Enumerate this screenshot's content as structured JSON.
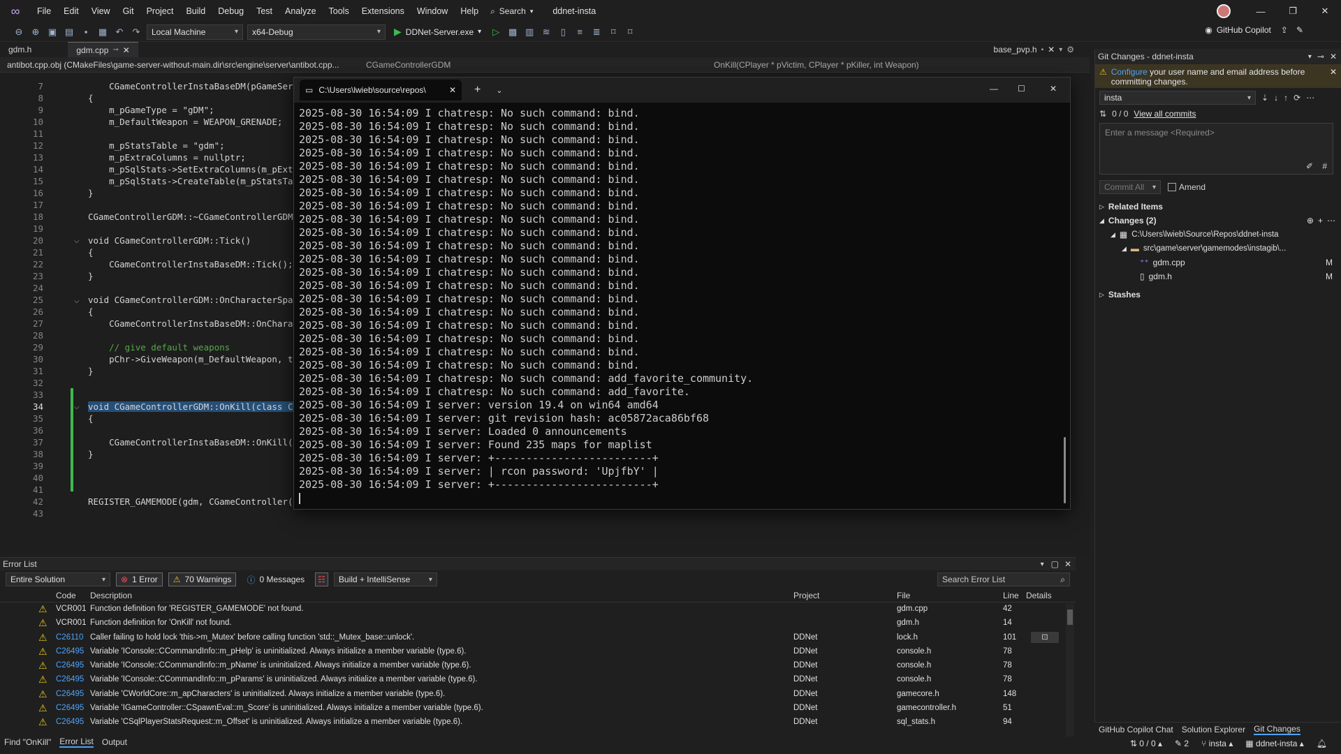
{
  "menubar": {
    "items": [
      "File",
      "Edit",
      "View",
      "Git",
      "Project",
      "Build",
      "Debug",
      "Test",
      "Analyze",
      "Tools",
      "Extensions",
      "Window",
      "Help"
    ],
    "search_label": "Search",
    "project_name": "ddnet-insta"
  },
  "toolbar": {
    "target": "Local Machine",
    "configuration": "x64-Debug",
    "startup_item": "DDNet-Server.exe",
    "copilot_label": "GitHub Copilot"
  },
  "doctabs": {
    "tab1": "gdm.h",
    "tab2": "gdm.cpp",
    "tab3": "base_pvp.h"
  },
  "navbar": {
    "file": "antibot.cpp.obj (CMakeFiles\\game-server-without-main.dir\\src\\engine\\server\\antibot.cpp...",
    "scope": "CGameControllerGDM",
    "member": "OnKill(CPlayer * pVictim, CPlayer * pKiller, int Weapon)"
  },
  "editor": {
    "line_numbers": [
      "7",
      "8",
      "9",
      "10",
      "11",
      "12",
      "13",
      "14",
      "15",
      "16",
      "17",
      "18",
      "19",
      "20",
      "21",
      "22",
      "23",
      "24",
      "25",
      "26",
      "27",
      "28",
      "29",
      "30",
      "31",
      "32",
      "33",
      "34",
      "35",
      "36",
      "37",
      "38",
      "39",
      "40",
      "41",
      "42",
      "43"
    ],
    "current_line": "34",
    "lines": {
      "l7": "    CGameControllerInstaBaseDM(pGameServer)",
      "l8": "{",
      "l9": "    m_pGameType = \"gDM\";",
      "l10": "    m_DefaultWeapon = WEAPON_GRENADE;",
      "l12": "    m_pStatsTable = \"gdm\";",
      "l13": "    m_pExtraColumns = nullptr;",
      "l14": "    m_pSqlStats->SetExtraColumns(m_pExt",
      "l15": "    m_pSqlStats->CreateTable(m_pStatsTa",
      "l16": "}",
      "l18": "CGameControllerGDM::~CGameControllerGDM",
      "l20": "void CGameControllerGDM::Tick()",
      "l21": "{",
      "l22": "    CGameControllerInstaBaseDM::Tick();",
      "l23": "}",
      "l25": "void CGameControllerGDM::OnCharacterSpa",
      "l26": "{",
      "l27": "    CGameControllerInstaBaseDM::OnChara",
      "l29": "    // give default weapons",
      "l30": "    pChr->GiveWeapon(m_DefaultWeapon, t",
      "l31": "}",
      "l34": "void CGameControllerGDM::OnKill(class C",
      "l35": "{",
      "l37": "    CGameControllerInstaBaseDM::OnKill(",
      "l38": "}",
      "l42": "REGISTER_GAMEMODE(gdm, CGameController("
    }
  },
  "terminal": {
    "tab_title": "C:\\Users\\lwieb\\source\\repos\\",
    "lines": [
      "2025-08-30 16:54:09 I chatresp: No such command: bind.",
      "2025-08-30 16:54:09 I chatresp: No such command: bind.",
      "2025-08-30 16:54:09 I chatresp: No such command: bind.",
      "2025-08-30 16:54:09 I chatresp: No such command: bind.",
      "2025-08-30 16:54:09 I chatresp: No such command: bind.",
      "2025-08-30 16:54:09 I chatresp: No such command: bind.",
      "2025-08-30 16:54:09 I chatresp: No such command: bind.",
      "2025-08-30 16:54:09 I chatresp: No such command: bind.",
      "2025-08-30 16:54:09 I chatresp: No such command: bind.",
      "2025-08-30 16:54:09 I chatresp: No such command: bind.",
      "2025-08-30 16:54:09 I chatresp: No such command: bind.",
      "2025-08-30 16:54:09 I chatresp: No such command: bind.",
      "2025-08-30 16:54:09 I chatresp: No such command: bind.",
      "2025-08-30 16:54:09 I chatresp: No such command: bind.",
      "2025-08-30 16:54:09 I chatresp: No such command: bind.",
      "2025-08-30 16:54:09 I chatresp: No such command: bind.",
      "2025-08-30 16:54:09 I chatresp: No such command: bind.",
      "2025-08-30 16:54:09 I chatresp: No such command: bind.",
      "2025-08-30 16:54:09 I chatresp: No such command: bind.",
      "2025-08-30 16:54:09 I chatresp: No such command: bind.",
      "2025-08-30 16:54:09 I chatresp: No such command: add_favorite_community.",
      "2025-08-30 16:54:09 I chatresp: No such command: add_favorite.",
      "2025-08-30 16:54:09 I server: version 19.4 on win64 amd64",
      "2025-08-30 16:54:09 I server: git revision hash: ac05872aca86bf68",
      "2025-08-30 16:54:09 I server: Loaded 0 announcements",
      "2025-08-30 16:54:09 I server: Found 235 maps for maplist",
      "2025-08-30 16:54:09 I server: +-------------------------+",
      "2025-08-30 16:54:09 I server: | rcon password: 'UpjfbY' |",
      "2025-08-30 16:54:09 I server: +-------------------------+"
    ]
  },
  "git": {
    "title": "Git Changes - ddnet-insta",
    "warning_link": "Configure",
    "warning_text": " your user name and email address before committing changes.",
    "branch": "insta",
    "outgoing": "0 / 0",
    "view_commits": "View all commits",
    "message_placeholder": "Enter a message <Required>",
    "commit_all": "Commit All",
    "amend": "Amend",
    "related_items": "Related Items",
    "changes": "Changes (2)",
    "repo_path": "C:\\Users\\lwieb\\Source\\Repos\\ddnet-insta",
    "folder_path": "src\\game\\server\\gamemodes\\instagib\\...",
    "file1": "gdm.cpp",
    "file1_status": "M",
    "file2": "gdm.h",
    "file2_status": "M",
    "stashes": "Stashes"
  },
  "errorlist": {
    "title": "Error List",
    "scope": "Entire Solution",
    "errors": "1 Error",
    "warnings": "70 Warnings",
    "messages": "0 Messages",
    "source": "Build + IntelliSense",
    "search_placeholder": "Search Error List",
    "columns": {
      "code": "Code",
      "description": "Description",
      "project": "Project",
      "file": "File",
      "line": "Line",
      "details": "Details"
    },
    "rows": [
      {
        "code": "VCR001",
        "description": "Function definition for 'REGISTER_GAMEMODE' not found.",
        "project": "",
        "file": "gdm.cpp",
        "line": "42"
      },
      {
        "code": "VCR001",
        "description": "Function definition for 'OnKill' not found.",
        "project": "",
        "file": "gdm.h",
        "line": "14"
      },
      {
        "code": "C26110",
        "description": "Caller failing to hold lock 'this->m_Mutex' before calling function 'std::_Mutex_base::unlock'.",
        "project": "DDNet",
        "file": "lock.h",
        "line": "101"
      },
      {
        "code": "C26495",
        "description": "Variable 'IConsole::CCommandInfo::m_pHelp' is uninitialized. Always initialize a member variable (type.6).",
        "project": "DDNet",
        "file": "console.h",
        "line": "78"
      },
      {
        "code": "C26495",
        "description": "Variable 'IConsole::CCommandInfo::m_pName' is uninitialized. Always initialize a member variable (type.6).",
        "project": "DDNet",
        "file": "console.h",
        "line": "78"
      },
      {
        "code": "C26495",
        "description": "Variable 'IConsole::CCommandInfo::m_pParams' is uninitialized. Always initialize a member variable (type.6).",
        "project": "DDNet",
        "file": "console.h",
        "line": "78"
      },
      {
        "code": "C26495",
        "description": "Variable 'CWorldCore::m_apCharacters' is uninitialized. Always initialize a member variable (type.6).",
        "project": "DDNet",
        "file": "gamecore.h",
        "line": "148"
      },
      {
        "code": "C26495",
        "description": "Variable 'IGameController::CSpawnEval::m_Score' is uninitialized. Always initialize a member variable (type.6).",
        "project": "DDNet",
        "file": "gamecontroller.h",
        "line": "51"
      },
      {
        "code": "C26495",
        "description": "Variable 'CSqlPlayerStatsRequest::m_Offset' is uninitialized. Always initialize a member variable (type.6).",
        "project": "DDNet",
        "file": "sql_stats.h",
        "line": "94"
      }
    ]
  },
  "bottomtabs": {
    "find": "Find \"OnKill\"",
    "errorlist": "Error List",
    "output": "Output"
  },
  "righttabs": {
    "copilot_chat": "GitHub Copilot Chat",
    "solution_explorer": "Solution Explorer",
    "git_changes": "Git Changes"
  },
  "status": {
    "sync": "0 / 0",
    "pending": "2",
    "branch": "insta",
    "repo": "ddnet-insta"
  },
  "colors": {
    "accent": "#4fa3f7",
    "warning": "#e3c41f",
    "error": "#f14c4c",
    "added": "#3fb950"
  }
}
